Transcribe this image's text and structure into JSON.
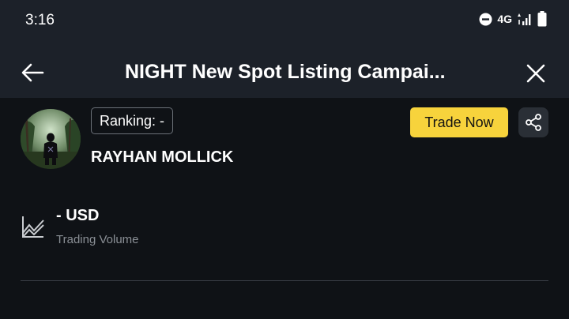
{
  "status_bar": {
    "time": "3:16",
    "network": "4G"
  },
  "app_bar": {
    "title": "NIGHT New Spot Listing Campai..."
  },
  "profile": {
    "ranking": "Ranking: -",
    "username": "RAYHAN MOLLICK"
  },
  "actions": {
    "trade_now_label": "Trade Now"
  },
  "stats": {
    "volume_value": "- USD",
    "volume_label": "Trading Volume"
  },
  "colors": {
    "accent": "#f7d33c",
    "background": "#0f1216",
    "header": "#1c2129"
  }
}
